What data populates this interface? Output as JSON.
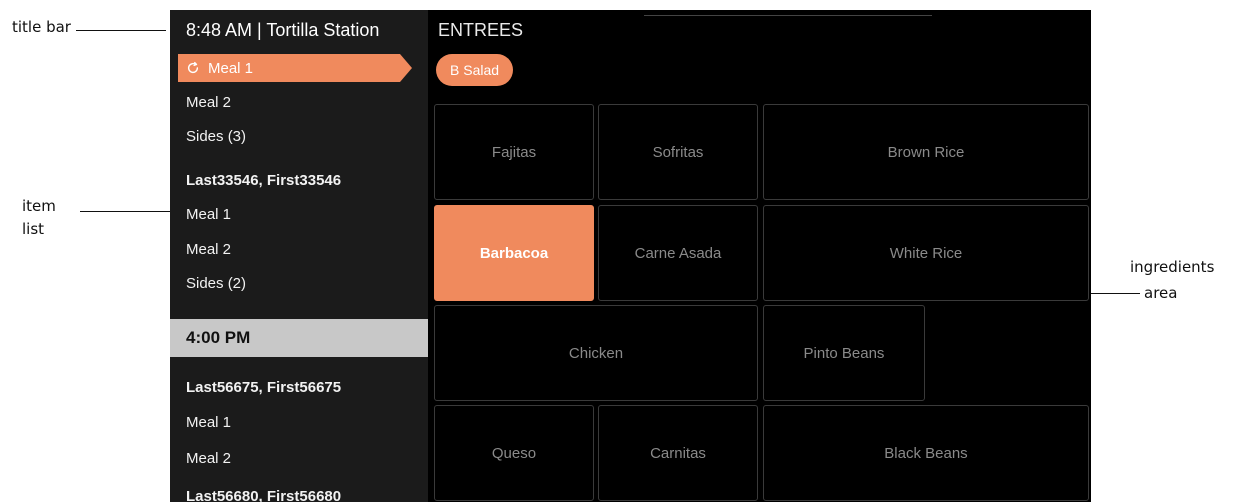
{
  "annotations": {
    "title_bar": "title bar",
    "item_list": [
      "item",
      "list"
    ],
    "ingredients_area": [
      "ingredients",
      "area"
    ]
  },
  "sidebar": {
    "title": "8:48 AM | Tortilla Station",
    "items": [
      {
        "label": "Meal 1",
        "selected": true,
        "icon": "refresh-icon"
      },
      {
        "label": "Meal 2"
      },
      {
        "label": "Sides (3)"
      },
      {
        "label": "Last33546, First33546",
        "bold": true
      },
      {
        "label": "Meal 1"
      },
      {
        "label": "Meal 2"
      },
      {
        "label": "Sides (2)"
      }
    ],
    "time_header": "4:00 PM",
    "items2": [
      {
        "label": "Last56675, First56675",
        "bold": true
      },
      {
        "label": "Meal 1"
      },
      {
        "label": "Meal 2"
      },
      {
        "label": "Last56680, First56680",
        "bold": true
      }
    ]
  },
  "main": {
    "section": "ENTREES",
    "chip": "B Salad",
    "tiles": [
      {
        "label": "Fajitas"
      },
      {
        "label": "Sofritas"
      },
      {
        "label": "Brown Rice"
      },
      {
        "label": "Barbacoa",
        "selected": true
      },
      {
        "label": "Carne Asada"
      },
      {
        "label": "White Rice"
      },
      {
        "label": "Chicken"
      },
      {
        "label": "Pinto Beans"
      },
      {
        "label": "Queso"
      },
      {
        "label": "Carnitas"
      },
      {
        "label": "Black Beans"
      }
    ]
  },
  "colors": {
    "accent": "#f08a5d",
    "sidebar_bg": "#1b1b1b",
    "main_bg": "#000000",
    "time_header_bg": "#c8c8c8"
  }
}
